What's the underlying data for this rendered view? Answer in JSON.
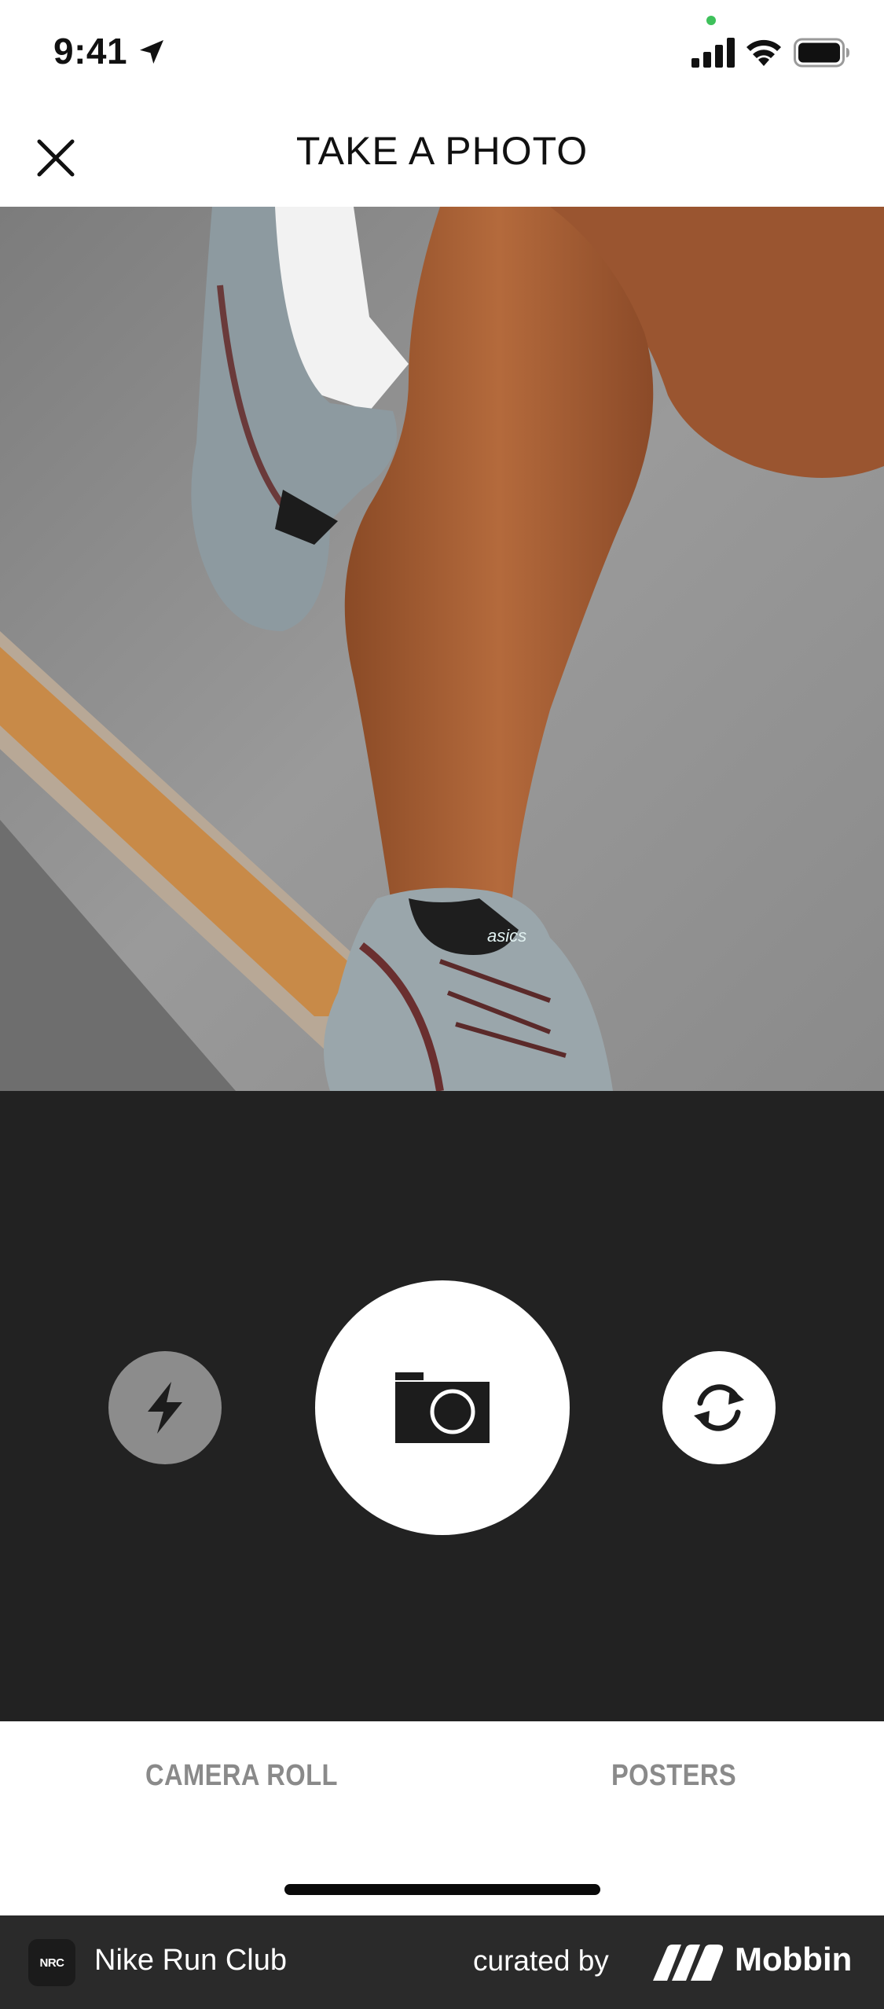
{
  "status_bar": {
    "time": "9:41"
  },
  "header": {
    "title": "TAKE A PHOTO"
  },
  "camera": {
    "shoe_brand_text": "asics"
  },
  "tabs": [
    {
      "label": "CAMERA ROLL"
    },
    {
      "label": "POSTERS"
    }
  ],
  "footer": {
    "logo_text": "NRC",
    "app_name": "Nike Run Club",
    "curated_label": "curated by",
    "brand_name": "Mobbin"
  },
  "colors": {
    "controls_bg": "#222222",
    "flash_bg": "#8c8c8c",
    "tab_text": "#8a8a8a",
    "footer_bg": "#2a2a2a"
  },
  "icons": [
    "location-arrow-icon",
    "cellular-signal-icon",
    "wifi-icon",
    "battery-icon",
    "close-icon",
    "flash-icon",
    "camera-icon",
    "flip-camera-icon",
    "mobbin-logo-icon"
  ]
}
